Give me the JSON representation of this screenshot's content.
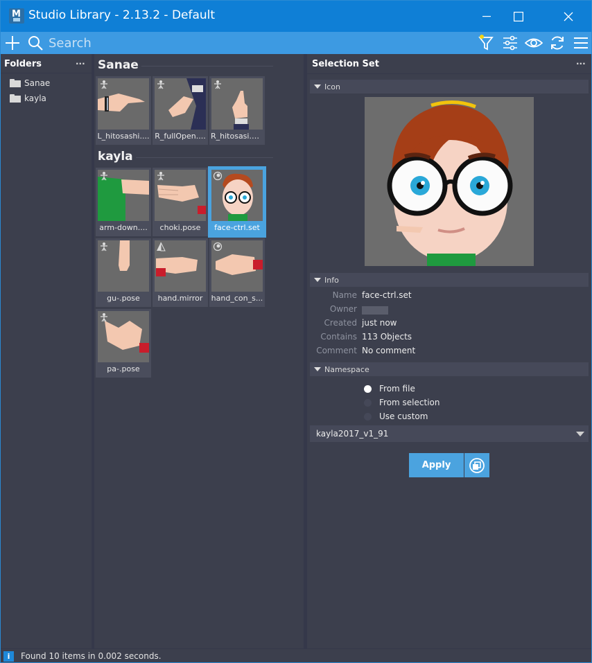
{
  "window": {
    "title": "Studio Library - 2.13.2 - Default",
    "app_icon_letter": "M"
  },
  "toolbar": {
    "search_placeholder": "Search",
    "icons": [
      "plus-icon",
      "search-icon",
      "filter-icon",
      "sliders-icon",
      "eye-icon",
      "sync-icon",
      "menu-icon"
    ]
  },
  "folders": {
    "header": "Folders",
    "menu": "...",
    "items": [
      {
        "label": "Sanae"
      },
      {
        "label": "kayla"
      }
    ]
  },
  "library": {
    "groups": [
      {
        "title": "Sanae",
        "items": [
          {
            "label": "L_hitosashi....",
            "type": "pose"
          },
          {
            "label": "R_fullOpen....",
            "type": "pose"
          },
          {
            "label": "R_hitosasi.p...",
            "type": "pose"
          }
        ]
      },
      {
        "title": "kayla",
        "items": [
          {
            "label": "arm-down....",
            "type": "pose"
          },
          {
            "label": "choki.pose",
            "type": "pose"
          },
          {
            "label": "face-ctrl.set",
            "type": "set",
            "selected": true
          },
          {
            "label": "gu-.pose",
            "type": "pose"
          },
          {
            "label": "hand.mirror",
            "type": "mirror"
          },
          {
            "label": "hand_con_s...",
            "type": "set"
          },
          {
            "label": "pa-.pose",
            "type": "pose"
          }
        ]
      }
    ]
  },
  "selection": {
    "title": "Selection Set",
    "menu": "...",
    "icon_section": "Icon",
    "info_section": "Info",
    "info": [
      {
        "key": "Name",
        "value": "face-ctrl.set"
      },
      {
        "key": "Owner",
        "value": ""
      },
      {
        "key": "Created",
        "value": "just now"
      },
      {
        "key": "Contains",
        "value": "113 Objects"
      },
      {
        "key": "Comment",
        "value": "No comment"
      }
    ],
    "namespace_section": "Namespace",
    "namespace_options": [
      {
        "label": "From file",
        "selected": true
      },
      {
        "label": "From selection",
        "selected": false
      },
      {
        "label": "Use custom",
        "selected": false
      }
    ],
    "namespace_value": "kayla2017_v1_91",
    "apply_label": "Apply"
  },
  "status": {
    "icon": "i",
    "text": "Found 10 items in 0.002 seconds."
  },
  "colors": {
    "titlebar": "#0f7fd6",
    "toolbar": "#3d9ae2",
    "panel": "#3c3f4d",
    "accent": "#4aa3df"
  }
}
